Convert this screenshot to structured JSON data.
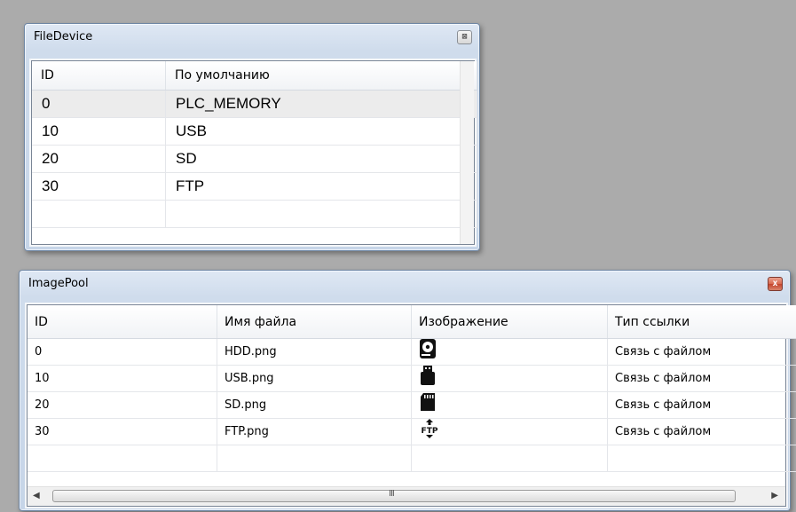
{
  "file_device": {
    "title": "FileDevice",
    "close_glyph": "⊠",
    "columns": [
      "ID",
      "По умолчанию"
    ],
    "rows": [
      {
        "id": "0",
        "default": "PLC_MEMORY"
      },
      {
        "id": "10",
        "default": "USB"
      },
      {
        "id": "20",
        "default": "SD"
      },
      {
        "id": "30",
        "default": "FTP"
      }
    ]
  },
  "image_pool": {
    "title": "ImagePool",
    "close_glyph": "x",
    "columns": [
      "ID",
      "Имя файла",
      "Изображение",
      "Тип ссылки"
    ],
    "rows": [
      {
        "id": "0",
        "file": "HDD.png",
        "image": "hdd-icon",
        "link": "Связь с файлом"
      },
      {
        "id": "10",
        "file": "USB.png",
        "image": "usb-icon",
        "link": "Связь с файлом"
      },
      {
        "id": "20",
        "file": "SD.png",
        "image": "sd-card-icon",
        "link": "Связь с файлом"
      },
      {
        "id": "30",
        "file": "FTP.png",
        "image": "ftp-icon",
        "link": "Связь с файлом"
      }
    ],
    "scrollbar": {
      "left_arrow": "◀",
      "right_arrow": "▶",
      "grip": "III"
    }
  }
}
